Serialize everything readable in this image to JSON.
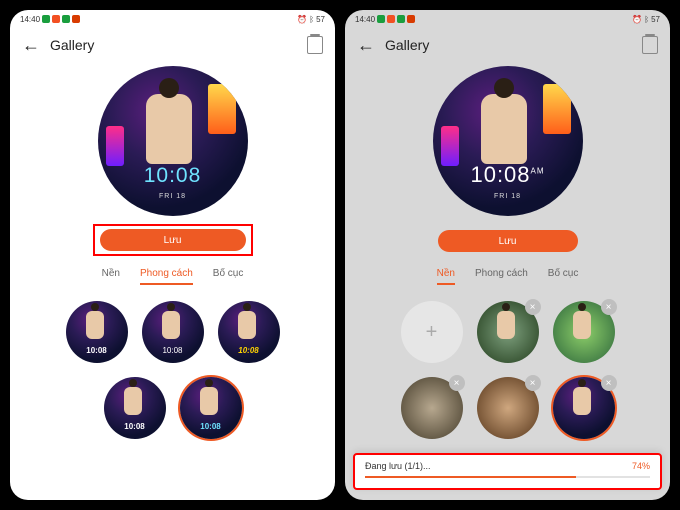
{
  "status": {
    "time": "14:40",
    "battery": "57"
  },
  "header": {
    "title": "Gallery"
  },
  "watchface": {
    "time_cyan": "10:08",
    "time_white": "10:08",
    "date": "FRI 18",
    "date_am": "AM"
  },
  "actions": {
    "save_label": "Lưu"
  },
  "tabs": {
    "nen": "Nền",
    "phongcach": "Phong cách",
    "bocuc": "Bố cục"
  },
  "thumbs": {
    "t1": "10:08",
    "t2": "10:08",
    "t3": "10:08",
    "t4": "10:08",
    "t5": "10:08"
  },
  "progress": {
    "label": "Đang lưu (1/1)...",
    "percent": "74%"
  },
  "icons": {
    "add": "+",
    "close": "×"
  }
}
